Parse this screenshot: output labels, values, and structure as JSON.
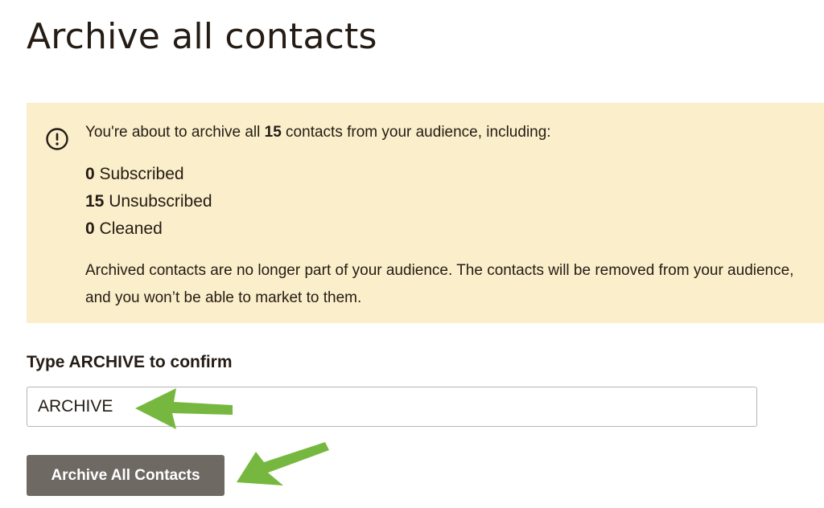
{
  "page": {
    "title": "Archive all contacts"
  },
  "warning": {
    "icon": "alert-circle-icon",
    "background_color": "#fbeeca",
    "intro_prefix": "You're about to archive all ",
    "intro_count": "15",
    "intro_suffix": " contacts from your audience, including:",
    "counts": [
      {
        "value": "0",
        "label": " Subscribed"
      },
      {
        "value": "15",
        "label": " Unsubscribed"
      },
      {
        "value": "0",
        "label": " Cleaned"
      }
    ],
    "description": "Archived contacts are no longer part of your audience. The contacts will be removed from your audience, and you won’t be able to market to them."
  },
  "confirm": {
    "label": "Type ARCHIVE to confirm",
    "input_value": "ARCHIVE"
  },
  "actions": {
    "archive_button_label": "Archive All Contacts",
    "button_color": "#6f6964"
  },
  "annotations": {
    "arrow_color": "#76b83f",
    "arrow_icon": "green-arrow-icon"
  }
}
